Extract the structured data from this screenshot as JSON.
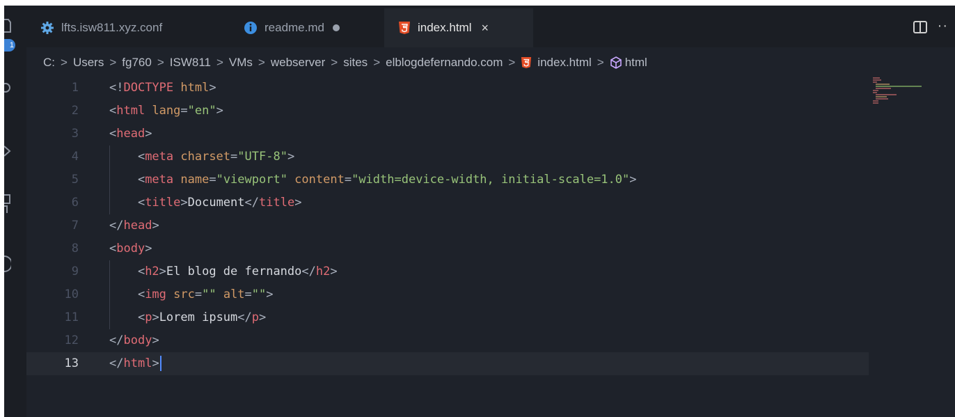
{
  "tabs": [
    {
      "label": "lfts.isw811.xyz.conf",
      "icon": "gear-icon",
      "icon_color": "#5fa8e6",
      "active": false
    },
    {
      "label": "readme.md",
      "icon": "info-icon",
      "icon_color": "#3c8ee0",
      "active": false,
      "modified": true
    },
    {
      "label": "index.html",
      "icon": "html5-icon",
      "icon_color": "#e44d26",
      "active": true,
      "close": "×"
    }
  ],
  "breadcrumb": {
    "separator": ">",
    "items": [
      "C:",
      "Users",
      "fg760",
      "ISW811",
      "VMs",
      "webserver",
      "sites",
      "elblogdefernando.com",
      "index.html",
      "html"
    ]
  },
  "activity": {
    "badge": "1"
  },
  "more_label": "··",
  "editor": {
    "current_line": 13,
    "lines": [
      {
        "n": "1",
        "tokens": [
          {
            "t": "<!",
            "c": "punct"
          },
          {
            "t": "DOCTYPE",
            "c": "tag"
          },
          {
            "t": " html",
            "c": "attr"
          },
          {
            "t": ">",
            "c": "punct"
          }
        ]
      },
      {
        "n": "2",
        "tokens": [
          {
            "t": "<",
            "c": "punct"
          },
          {
            "t": "html",
            "c": "tag"
          },
          {
            "t": " lang",
            "c": "attr"
          },
          {
            "t": "=",
            "c": "punct"
          },
          {
            "t": "\"en\"",
            "c": "str"
          },
          {
            "t": ">",
            "c": "punct"
          }
        ]
      },
      {
        "n": "3",
        "tokens": [
          {
            "t": "<",
            "c": "punct"
          },
          {
            "t": "head",
            "c": "tag"
          },
          {
            "t": ">",
            "c": "punct"
          }
        ]
      },
      {
        "n": "4",
        "tokens": [
          {
            "t": "    <",
            "c": "punct"
          },
          {
            "t": "meta",
            "c": "tag"
          },
          {
            "t": " charset",
            "c": "attr"
          },
          {
            "t": "=",
            "c": "punct"
          },
          {
            "t": "\"UTF-8\"",
            "c": "str"
          },
          {
            "t": ">",
            "c": "punct"
          }
        ]
      },
      {
        "n": "5",
        "tokens": [
          {
            "t": "    <",
            "c": "punct"
          },
          {
            "t": "meta",
            "c": "tag"
          },
          {
            "t": " name",
            "c": "attr"
          },
          {
            "t": "=",
            "c": "punct"
          },
          {
            "t": "\"viewport\"",
            "c": "str"
          },
          {
            "t": " content",
            "c": "attr"
          },
          {
            "t": "=",
            "c": "punct"
          },
          {
            "t": "\"width=device-width, initial-scale=1.0\"",
            "c": "str"
          },
          {
            "t": ">",
            "c": "punct"
          }
        ]
      },
      {
        "n": "6",
        "tokens": [
          {
            "t": "    <",
            "c": "punct"
          },
          {
            "t": "title",
            "c": "tag"
          },
          {
            "t": ">",
            "c": "punct"
          },
          {
            "t": "Document",
            "c": "text"
          },
          {
            "t": "</",
            "c": "punct"
          },
          {
            "t": "title",
            "c": "tag"
          },
          {
            "t": ">",
            "c": "punct"
          }
        ]
      },
      {
        "n": "7",
        "tokens": [
          {
            "t": "</",
            "c": "punct"
          },
          {
            "t": "head",
            "c": "tag"
          },
          {
            "t": ">",
            "c": "punct"
          }
        ]
      },
      {
        "n": "8",
        "tokens": [
          {
            "t": "<",
            "c": "punct"
          },
          {
            "t": "body",
            "c": "tag"
          },
          {
            "t": ">",
            "c": "punct"
          }
        ]
      },
      {
        "n": "9",
        "tokens": [
          {
            "t": "    <",
            "c": "punct"
          },
          {
            "t": "h2",
            "c": "tag"
          },
          {
            "t": ">",
            "c": "punct"
          },
          {
            "t": "El blog de fernando",
            "c": "text"
          },
          {
            "t": "</",
            "c": "punct"
          },
          {
            "t": "h2",
            "c": "tag"
          },
          {
            "t": ">",
            "c": "punct"
          }
        ]
      },
      {
        "n": "10",
        "tokens": [
          {
            "t": "    <",
            "c": "punct"
          },
          {
            "t": "img",
            "c": "tag"
          },
          {
            "t": " src",
            "c": "attr"
          },
          {
            "t": "=",
            "c": "punct"
          },
          {
            "t": "\"\"",
            "c": "str"
          },
          {
            "t": " alt",
            "c": "attr"
          },
          {
            "t": "=",
            "c": "punct"
          },
          {
            "t": "\"\"",
            "c": "str"
          },
          {
            "t": ">",
            "c": "punct"
          }
        ]
      },
      {
        "n": "11",
        "tokens": [
          {
            "t": "    <",
            "c": "punct"
          },
          {
            "t": "p",
            "c": "tag"
          },
          {
            "t": ">",
            "c": "punct"
          },
          {
            "t": "Lorem ipsum",
            "c": "text"
          },
          {
            "t": "</",
            "c": "punct"
          },
          {
            "t": "p",
            "c": "tag"
          },
          {
            "t": ">",
            "c": "punct"
          }
        ]
      },
      {
        "n": "12",
        "tokens": [
          {
            "t": "</",
            "c": "punct"
          },
          {
            "t": "body",
            "c": "tag"
          },
          {
            "t": ">",
            "c": "punct"
          }
        ]
      },
      {
        "n": "13",
        "tokens": [
          {
            "t": "</",
            "c": "punct"
          },
          {
            "t": "html",
            "c": "tag"
          },
          {
            "t": ">",
            "c": "punct"
          }
        ]
      }
    ]
  }
}
